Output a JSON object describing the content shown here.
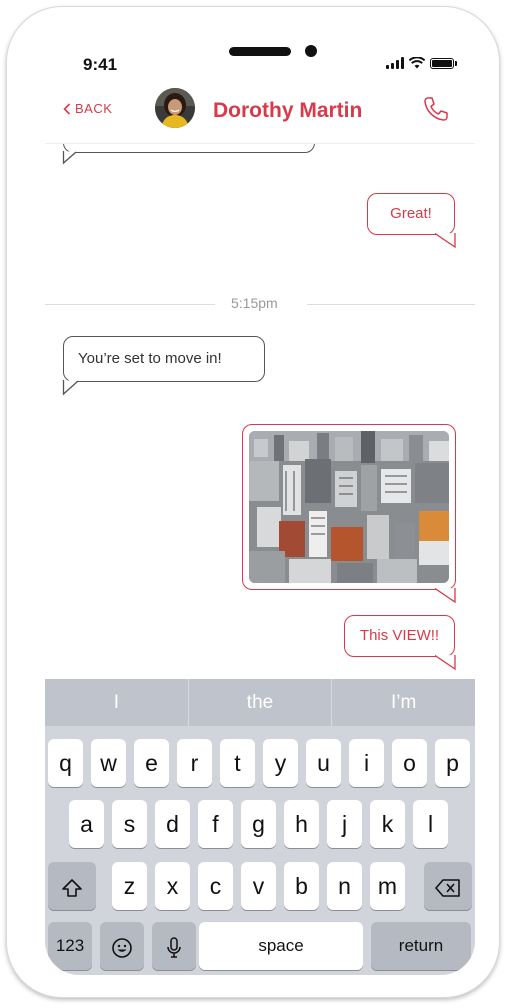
{
  "status_bar": {
    "time": "9:41"
  },
  "header": {
    "back_label": "BACK",
    "contact_name": "Dorothy Martin",
    "accent_color": "#d93a4a",
    "avatar_icon": "avatar-photo",
    "call_icon": "phone-icon"
  },
  "messages": {
    "sent_1": "Great!",
    "timestamp": "5:15pm",
    "received_1": "You’re set to move in!",
    "sent_photo_icon": "city-photo",
    "sent_2": "This VIEW!!"
  },
  "keyboard": {
    "suggestions": [
      "I",
      "the",
      "I’m"
    ],
    "row1": [
      "q",
      "w",
      "e",
      "r",
      "t",
      "y",
      "u",
      "i",
      "o",
      "p"
    ],
    "row2": [
      "a",
      "s",
      "d",
      "f",
      "g",
      "h",
      "j",
      "k",
      "l"
    ],
    "row3": [
      "z",
      "x",
      "c",
      "v",
      "b",
      "n",
      "m"
    ],
    "numbers_label": "123",
    "space_label": "space",
    "return_label": "return"
  }
}
